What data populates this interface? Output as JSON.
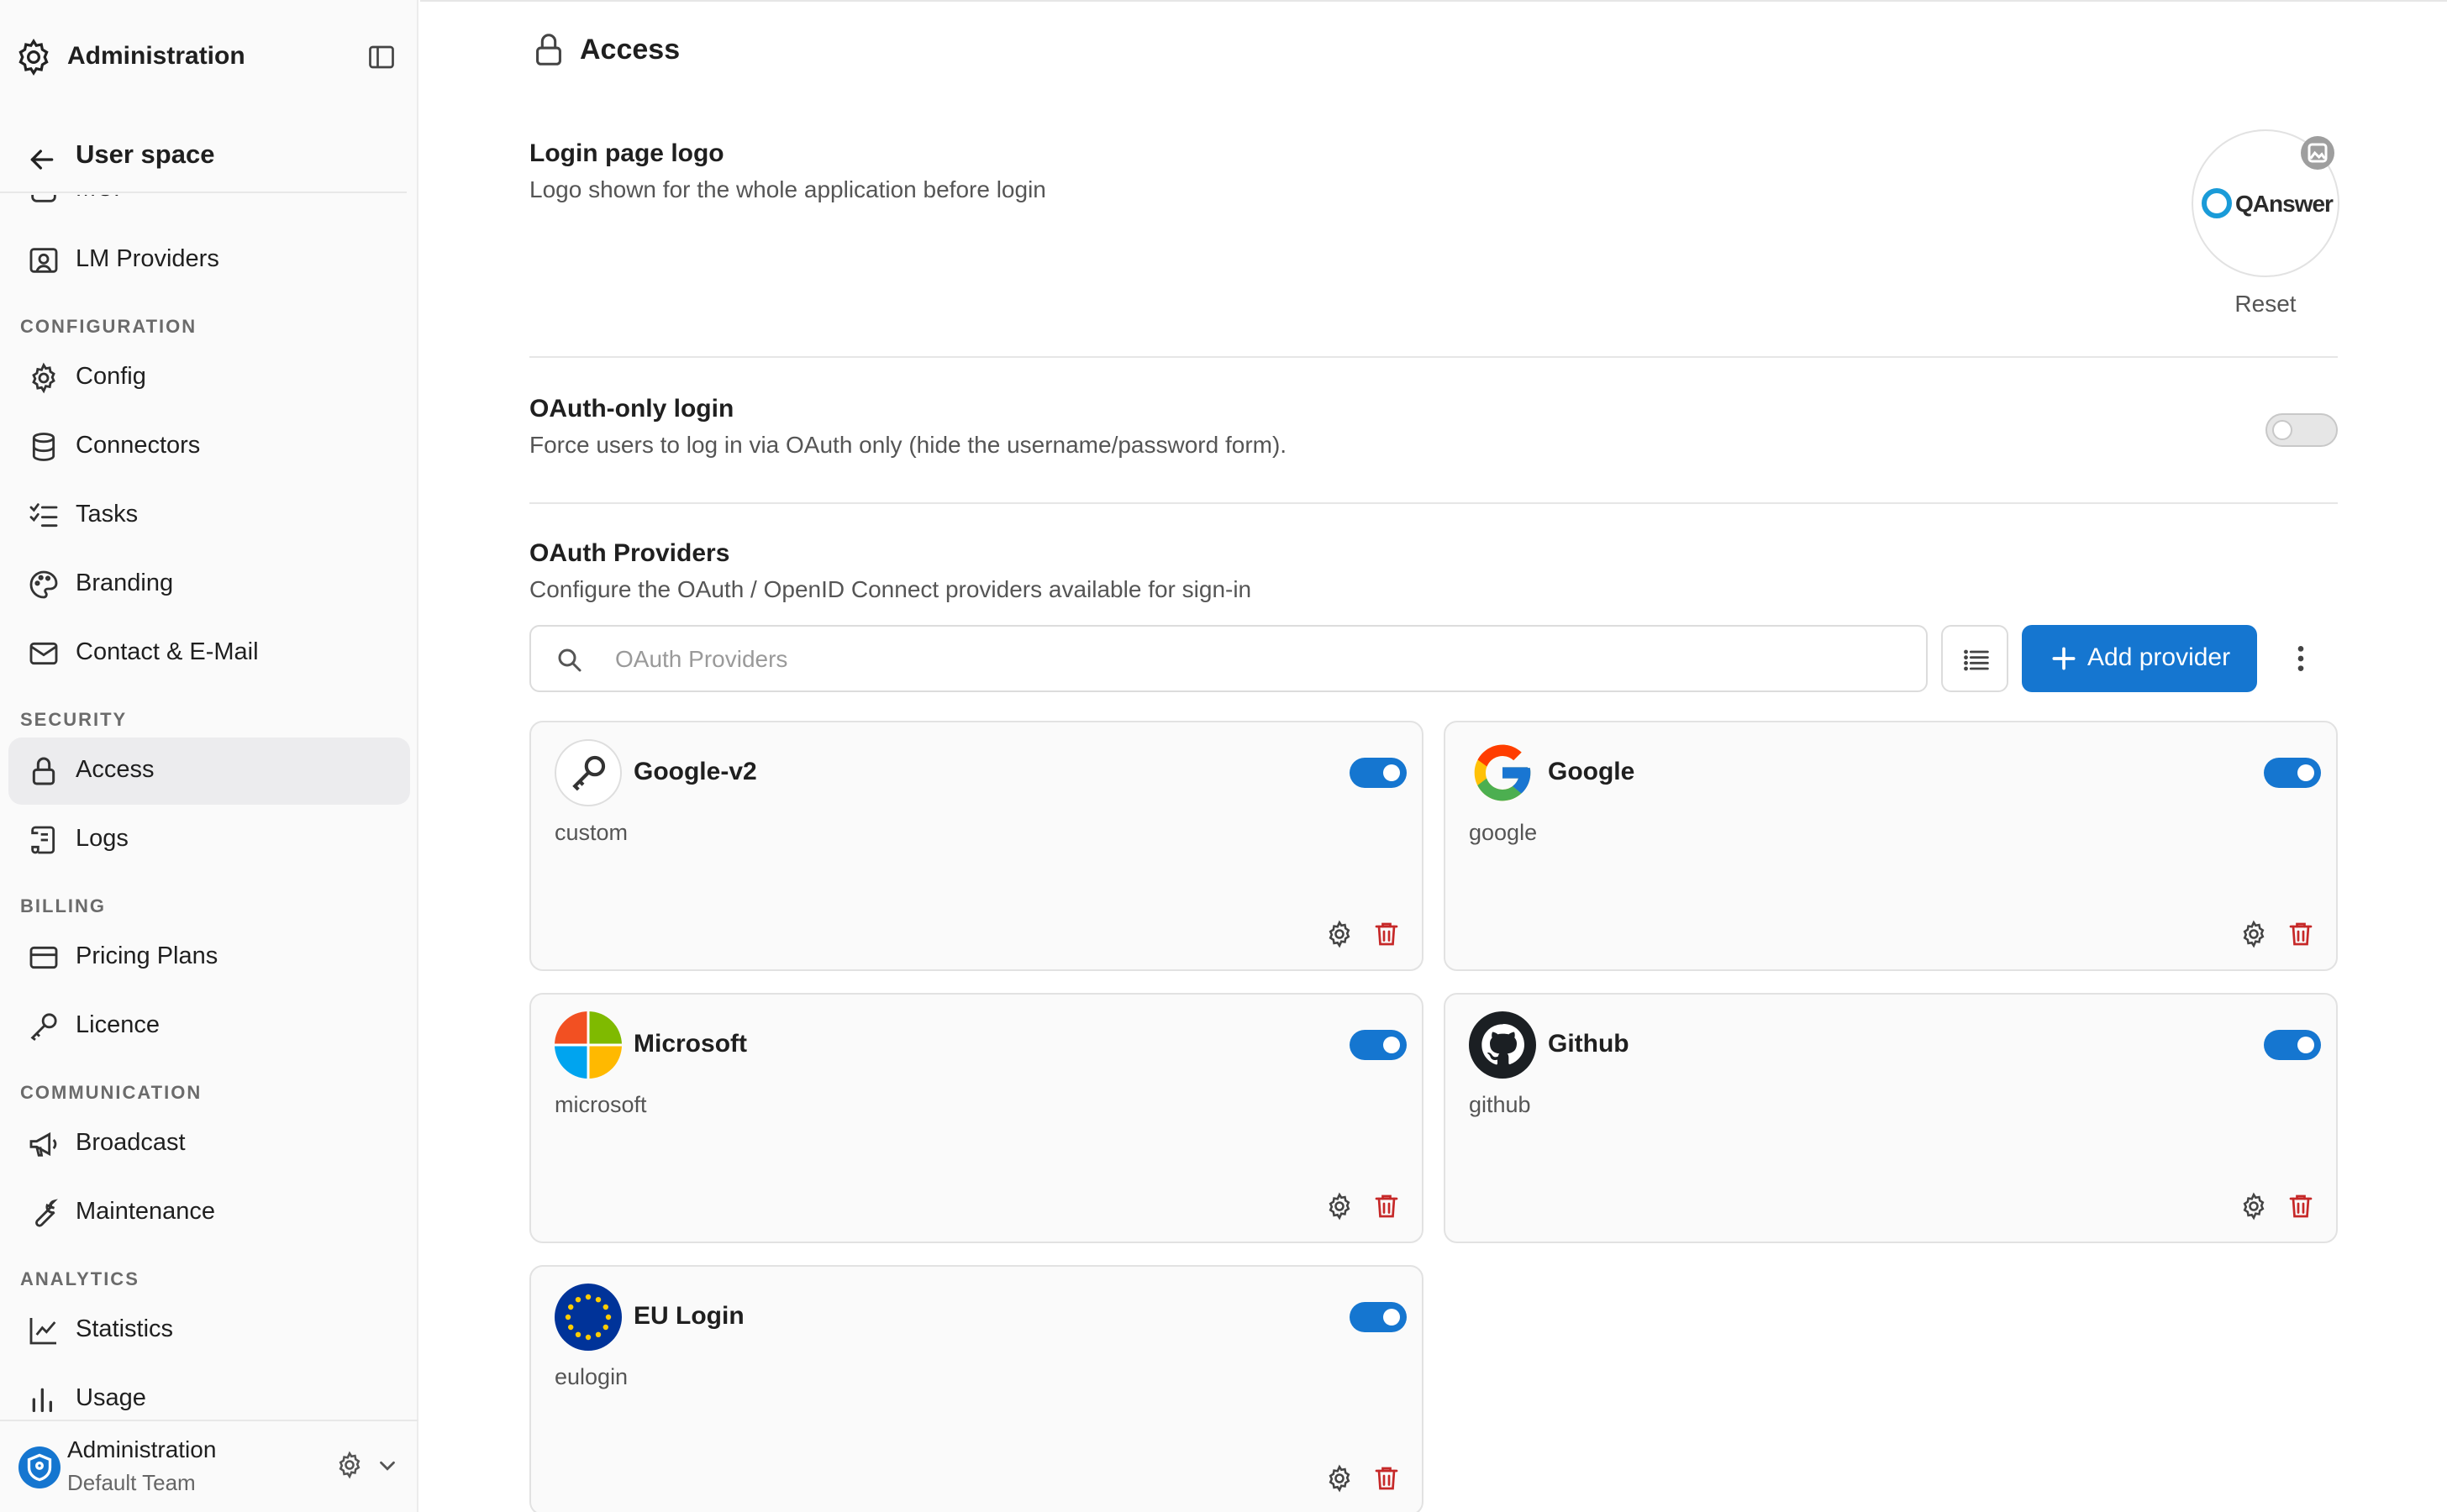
{
  "sidebar": {
    "title": "Administration",
    "back_label": "User space",
    "partial_item": "MCP",
    "items": [
      {
        "label": "LM Providers",
        "icon": "lm-providers-icon"
      },
      {
        "label": "Config",
        "icon": "gear-icon"
      },
      {
        "label": "Connectors",
        "icon": "database-icon"
      },
      {
        "label": "Tasks",
        "icon": "checklist-icon"
      },
      {
        "label": "Branding",
        "icon": "palette-icon"
      },
      {
        "label": "Contact & E-Mail",
        "icon": "mail-icon"
      },
      {
        "label": "Access",
        "icon": "lock-icon",
        "active": true
      },
      {
        "label": "Logs",
        "icon": "scroll-icon"
      },
      {
        "label": "Pricing Plans",
        "icon": "credit-card-icon"
      },
      {
        "label": "Licence",
        "icon": "key-icon"
      },
      {
        "label": "Broadcast",
        "icon": "megaphone-icon"
      },
      {
        "label": "Maintenance",
        "icon": "wrench-icon"
      },
      {
        "label": "Statistics",
        "icon": "line-chart-icon"
      },
      {
        "label": "Usage",
        "icon": "bar-chart-icon"
      }
    ],
    "sections": {
      "configuration": "CONFIGURATION",
      "security": "SECURITY",
      "billing": "BILLING",
      "communication": "COMMUNICATION",
      "analytics": "ANALYTICS"
    },
    "footer": {
      "name": "Administration",
      "team": "Default Team"
    }
  },
  "page": {
    "title": "Access"
  },
  "login_logo": {
    "title": "Login page logo",
    "description": "Logo shown for the whole application before login",
    "brand": "QAnswer",
    "reset_label": "Reset"
  },
  "oauth_only": {
    "title": "OAuth-only login",
    "description": "Force users to log in via OAuth only (hide the username/password form).",
    "enabled": false
  },
  "oauth_providers": {
    "title": "OAuth Providers",
    "description": "Configure the OAuth / OpenID Connect providers available for sign-in",
    "search_placeholder": "OAuth Providers",
    "add_label": "Add provider",
    "providers": [
      {
        "name": "Google-v2",
        "type": "custom",
        "enabled": true,
        "icon": "key-icon"
      },
      {
        "name": "Google",
        "type": "google",
        "enabled": true,
        "icon": "google-icon"
      },
      {
        "name": "Microsoft",
        "type": "microsoft",
        "enabled": true,
        "icon": "microsoft-icon"
      },
      {
        "name": "Github",
        "type": "github",
        "enabled": true,
        "icon": "github-icon"
      },
      {
        "name": "EU Login",
        "type": "eulogin",
        "enabled": true,
        "icon": "eu-flag-icon"
      }
    ]
  },
  "colors": {
    "accent": "#1576d0",
    "danger": "#c62828",
    "text": "#1f1f1f",
    "muted": "#555555"
  }
}
